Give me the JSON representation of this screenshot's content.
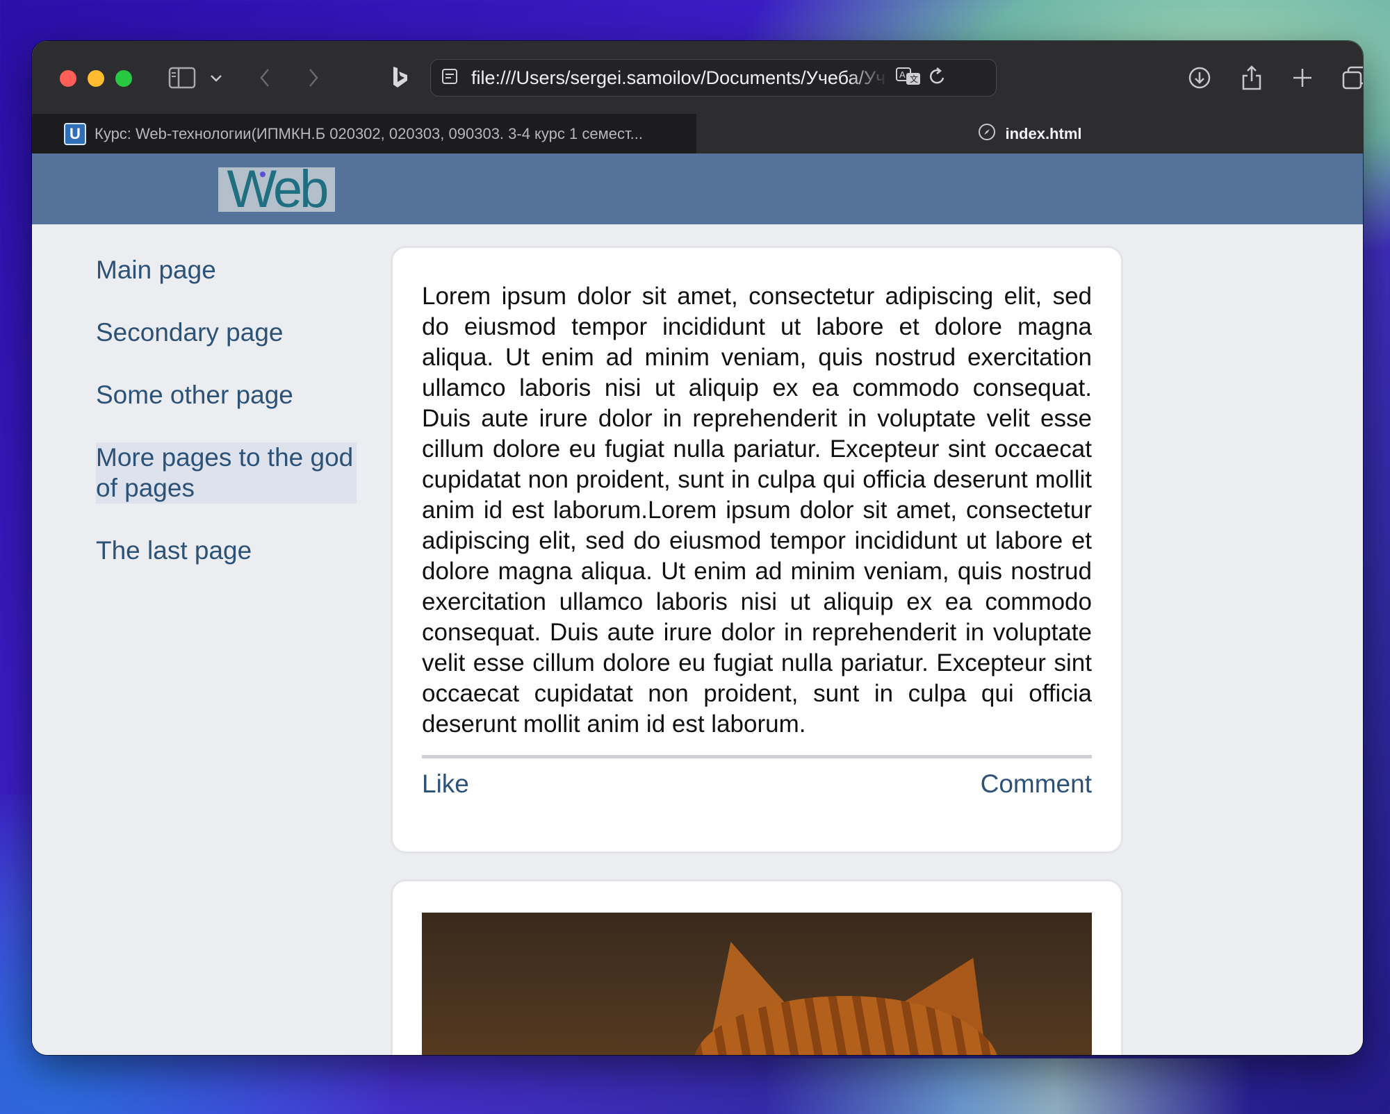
{
  "browser": {
    "url": "file:///Users/sergei.samoilov/Documents/Учеба/Уч",
    "tabs": [
      {
        "title": "Курс: Web-технологии(ИПМКН.Б 020302, 020303, 090303. 3-4 курс 1 семест...",
        "favicon": "U",
        "active": false
      },
      {
        "title": "index.html",
        "active": true
      }
    ]
  },
  "site": {
    "logo_text": "Web",
    "nav": [
      {
        "label": "Main page",
        "active": false
      },
      {
        "label": "Secondary page",
        "active": false
      },
      {
        "label": "Some other page",
        "active": false
      },
      {
        "label": "More pages to the god of pages",
        "active": true
      },
      {
        "label": "The last page",
        "active": false
      }
    ],
    "posts": [
      {
        "text": "Lorem ipsum dolor sit amet, consectetur adipiscing elit, sed do eiusmod tempor incididunt ut labore et dolore magna aliqua. Ut enim ad minim veniam, quis nostrud exercitation ullamco laboris nisi ut aliquip ex ea commodo consequat. Duis aute irure dolor in reprehenderit in voluptate velit esse cillum dolore eu fugiat nulla pariatur. Excepteur sint occaecat cupidatat non proident, sunt in culpa qui officia deserunt mollit anim id est laborum.Lorem ipsum dolor sit amet, consectetur adipiscing elit, sed do eiusmod tempor incididunt ut labore et dolore magna aliqua. Ut enim ad minim veniam, quis nostrud exercitation ullamco laboris nisi ut aliquip ex ea commodo consequat. Duis aute irure dolor in reprehenderit in voluptate velit esse cillum dolore eu fugiat nulla pariatur. Excepteur sint occaecat cupidatat non proident, sunt in culpa qui officia deserunt mollit anim id est laborum.",
        "like_label": "Like",
        "comment_label": "Comment"
      }
    ]
  },
  "colors": {
    "header": "#55729a",
    "link": "#2c5277",
    "page_bg": "#ecedf0"
  },
  "icons": [
    "sidebar-icon",
    "chevron-down-icon",
    "back-icon",
    "forward-icon",
    "bing-icon",
    "page-icon",
    "translate-icon",
    "reload-icon",
    "download-icon",
    "share-icon",
    "new-tab-icon",
    "tab-overview-icon",
    "close-icon",
    "compass-icon"
  ]
}
